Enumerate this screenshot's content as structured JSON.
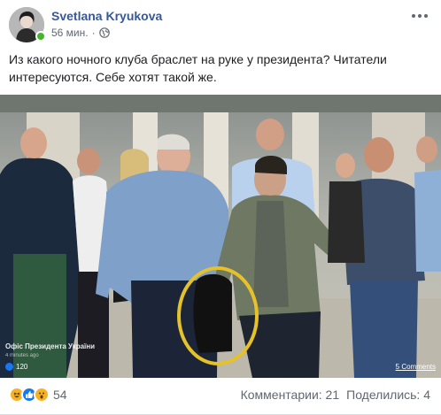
{
  "author": {
    "name": "Svetlana Kryukova",
    "time": "56 мин.",
    "separator": "·",
    "avatar_icon": "user-avatar",
    "privacy_icon": "globe-icon"
  },
  "post": {
    "text": "Из какого ночного клуба браслет на руке у президента? Читатели интересуются. Себе хотят такой же."
  },
  "photo": {
    "source_label": "Офіс Президента України",
    "source_sub": "4 minutes ago",
    "likes": "120",
    "comments": "5 Comments",
    "highlight_color": "#e5c12a"
  },
  "footer": {
    "reaction_count": "54",
    "comments": "Комментарии: 21",
    "shares": "Поделились: 4"
  },
  "colors": {
    "link": "#385898",
    "muted": "#606770",
    "online": "#42b72a",
    "like_blue": "#1877f2"
  }
}
